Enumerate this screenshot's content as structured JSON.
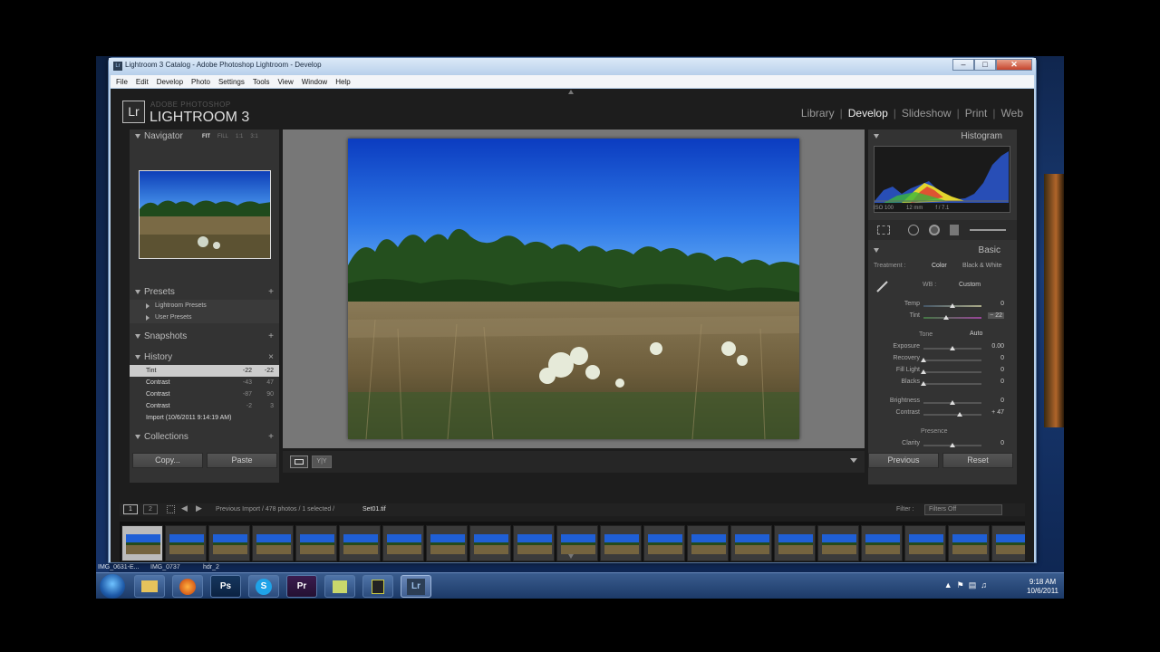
{
  "window_title": "Lightroom 3 Catalog - Adobe Photoshop Lightroom - Develop",
  "menu": [
    "File",
    "Edit",
    "Develop",
    "Photo",
    "Settings",
    "Tools",
    "View",
    "Window",
    "Help"
  ],
  "identity": {
    "logo": "Lr",
    "subtitle": "ADOBE PHOTOSHOP",
    "title": "LIGHTROOM 3"
  },
  "modules": [
    "Library",
    "Develop",
    "Slideshow",
    "Print",
    "Web"
  ],
  "left_panel": {
    "navigator": {
      "title": "Navigator",
      "zoom_fit": "FIT",
      "zoom_fill": "FILL",
      "zoom_1": "1:1",
      "zoom_3": "3:1"
    },
    "presets": {
      "title": "Presets",
      "items": [
        "Lightroom Presets",
        "User Presets"
      ]
    },
    "snapshots": {
      "title": "Snapshots"
    },
    "history": {
      "title": "History",
      "items": [
        {
          "name": "Tint",
          "a": "-22",
          "b": "-22"
        },
        {
          "name": "Contrast",
          "a": "-43",
          "b": "47"
        },
        {
          "name": "Contrast",
          "a": "-87",
          "b": "90"
        },
        {
          "name": "Contrast",
          "a": "-2",
          "b": "3"
        },
        {
          "name": "Import (10/6/2011 9:14:19 AM)",
          "a": "",
          "b": ""
        }
      ]
    },
    "collections": {
      "title": "Collections"
    },
    "copy_label": "Copy...",
    "paste_label": "Paste"
  },
  "right_panel": {
    "histogram_title": "Histogram",
    "meta": [
      "ISO 100",
      "12 mm",
      "f / 7.1"
    ],
    "basic_title": "Basic",
    "treatment_label": "Treatment :",
    "treatment_color": "Color",
    "treatment_bw": "Black & White",
    "wb_label": "WB :",
    "wb_value": "Custom",
    "tone_label": "Tone",
    "auto_label": "Auto",
    "presence_label": "Presence",
    "sliders": {
      "temp": {
        "label": "Temp",
        "value": "0",
        "level": 0.5
      },
      "tint": {
        "label": "Tint",
        "value": "− 22",
        "level": 0.39
      },
      "exposure": {
        "label": "Exposure",
        "value": "0.00",
        "level": 0.5
      },
      "recovery": {
        "label": "Recovery",
        "value": "0",
        "level": 0
      },
      "fill_light": {
        "label": "Fill Light",
        "value": "0",
        "level": 0
      },
      "blacks": {
        "label": "Blacks",
        "value": "0",
        "level": 0
      },
      "brightness": {
        "label": "Brightness",
        "value": "0",
        "level": 0.5
      },
      "contrast": {
        "label": "Contrast",
        "value": "+ 47",
        "level": 0.62
      },
      "clarity": {
        "label": "Clarity",
        "value": "0",
        "level": 0.5
      }
    },
    "previous_label": "Previous",
    "reset_label": "Reset"
  },
  "filmstrip": {
    "breadcrumb": "Previous Import / 478 photos / 1 selected / ",
    "filename": "Set01.tif",
    "filter_label": "Filter :",
    "filter_value": "Filters Off",
    "page1": "1",
    "page2": "2"
  },
  "desktop_labels": [
    "IMG_0631-E...",
    "IMG_0737",
    "hdr_2"
  ],
  "taskbar": {
    "apps": [
      "explorer",
      "firefox",
      "Ps",
      "skype",
      "Pr",
      "notes",
      "camera",
      "Lr"
    ],
    "time": "9:18 AM",
    "date": "10/6/2011"
  },
  "colors": {
    "accent": "#cccccc",
    "sky": "#1f5fd6",
    "panel": "#333333"
  }
}
